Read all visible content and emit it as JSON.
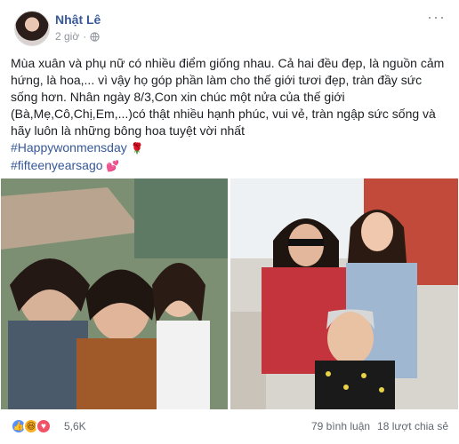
{
  "post": {
    "author": "Nhật Lê",
    "time": "2 giờ",
    "more_label": "···",
    "body_lines": [
      "Mùa xuân và phụ nữ có nhiều điểm giống nhau. Cả hai đều đẹp, là nguồn cảm",
      "hứng,  là hoa,... vì vậy họ góp phần làm cho thế giới tươi đẹp, tràn đầy sức",
      "sống hơn. Nhân ngày 8/3,Con xin chúc một nửa của thế giới",
      "(Bà,Mẹ,Cô,Chị,Em,...)có thật nhiều hạnh phúc, vui vẻ, tràn ngập sức sống và",
      "hãy luôn là những bông hoa tuyệt vời nhất"
    ],
    "hashtags": [
      "#Happywonmensday",
      "#fifteenyearsago"
    ],
    "hashtag_emojis": [
      "🌹",
      "💕"
    ],
    "reactions_count": "5,6K",
    "comments": "79 bình luận",
    "shares": "18 lượt chia sẻ"
  },
  "icons": {
    "globe": "globe-icon",
    "more": "more-options-icon",
    "like": "like-reaction-icon",
    "haha": "haha-reaction-icon",
    "love": "love-reaction-icon"
  },
  "colors": {
    "name": "#385898",
    "hashtag": "#365899",
    "meta": "#90949c"
  }
}
